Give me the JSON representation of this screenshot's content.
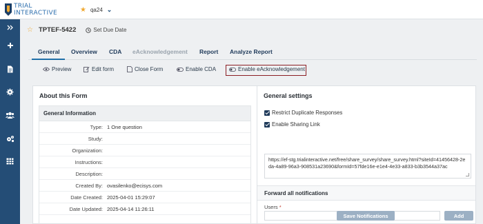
{
  "brand": {
    "line1": "TRIAL",
    "line2": "INTERACTIVE"
  },
  "project": {
    "name": "qa24"
  },
  "nav": {
    "collapse_icon": "double-chevron-right-icon",
    "icons": [
      "plus-icon",
      "document-icon",
      "gear-icon",
      "users-icon",
      "settings-cogs-icon",
      "table-icon"
    ]
  },
  "header": {
    "id": "TPTEF-5422",
    "due_label": "Set Due Date"
  },
  "tabs": [
    {
      "label": "General",
      "active": true
    },
    {
      "label": "Overview"
    },
    {
      "label": "CDA"
    },
    {
      "label": "eAcknowledgement",
      "disabled": true
    },
    {
      "label": "Report"
    },
    {
      "label": "Analyze Report"
    }
  ],
  "actions": [
    {
      "label": "Preview",
      "icon": "eye-icon"
    },
    {
      "label": "Edit form",
      "icon": "edit-icon"
    },
    {
      "label": "Close Form",
      "icon": "close-form-icon"
    },
    {
      "label": "Enable CDA",
      "icon": "toggle-icon"
    },
    {
      "label": "Enable eAcknowledgement",
      "icon": "toggle-icon"
    }
  ],
  "about": {
    "title": "About this Form",
    "section": "General Information",
    "rows": [
      {
        "key": "Type:",
        "value": "1 One question"
      },
      {
        "key": "Study:",
        "value": ""
      },
      {
        "key": "Organization:",
        "value": ""
      },
      {
        "key": "Instructions:",
        "value": ""
      },
      {
        "key": "Description:",
        "value": ""
      },
      {
        "key": "Created By:",
        "value": "ovasilenko@ecisys.com"
      },
      {
        "key": "Date Created:",
        "value": "2025-04-01 15:29:07"
      },
      {
        "key": "Date Updated:",
        "value": "2025-04-14 11:26:11"
      }
    ]
  },
  "settings": {
    "title": "General settings",
    "restrict_label": "Restrict Duplicate Responses",
    "sharing_label": "Enable Sharing Link",
    "url": "https://ef-stg.trialinteractive.net/free/share_survey/share_survey.html?siteId=41456428-2eda-4a89-96a3-908531a23690&formId=57fde16e-e1e4-4e33-a833-b3b3544a37ac",
    "forward_title": "Forward all notifications",
    "users_label": "Users",
    "required_mark": "*",
    "add_label": "Add",
    "save_label": "Save Notifications"
  },
  "colors": {
    "nav_bg": "#244d76",
    "brand_blue": "#2d6fae",
    "highlight": "#8a1c22",
    "button_bg": "#9cb0c4"
  }
}
